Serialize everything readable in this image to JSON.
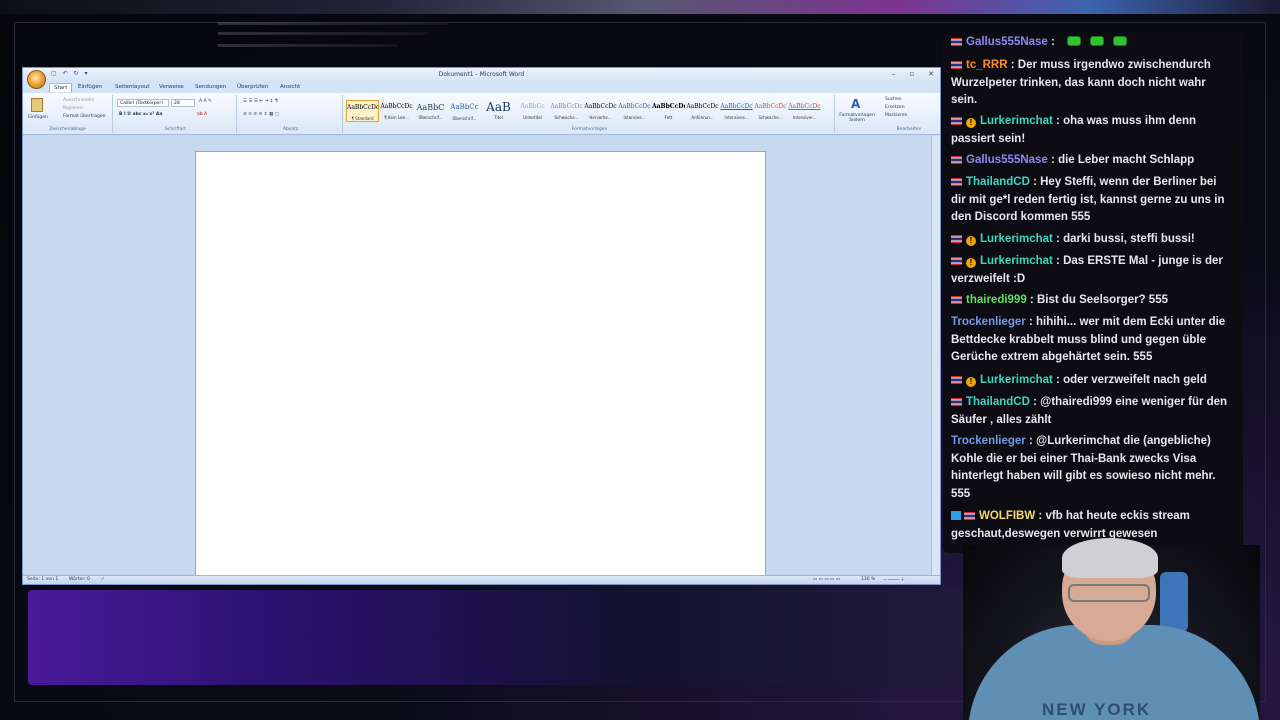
{
  "word": {
    "window_title": "Dokument1 - Microsoft Word",
    "quick_access": "▢ ↶ ↻ ▾",
    "tabs": [
      "Start",
      "Einfügen",
      "Seitenlayout",
      "Verweise",
      "Sendungen",
      "Überprüfen",
      "Ansicht"
    ],
    "clipboard": {
      "paste": "Einfügen",
      "cut": "Ausschneiden",
      "copy": "Kopieren",
      "format_painter": "Format übertragen",
      "label": "Zwischenablage"
    },
    "font": {
      "name": "Calibri (Textkörper)",
      "size": "28",
      "label": "Schriftart"
    },
    "paragraph_label": "Absatz",
    "styles": [
      {
        "preview": "AaBbCcDc",
        "name": "¶ Standard"
      },
      {
        "preview": "AaBbCcDc",
        "name": "¶ Kein Lee..."
      },
      {
        "preview": "AaBbC",
        "name": "Überschrif..."
      },
      {
        "preview": "AaBbCc",
        "name": "Überschrif..."
      },
      {
        "preview": "AaB",
        "name": "Titel"
      },
      {
        "preview": "AaBbCc",
        "name": "Untertitel"
      },
      {
        "preview": "AaBbCcDc",
        "name": "Schwache..."
      },
      {
        "preview": "AaBbCcDc",
        "name": "Hervorhe..."
      },
      {
        "preview": "AaBbCcDc",
        "name": "Intensive..."
      },
      {
        "preview": "AaBbCcDc",
        "name": "Fett"
      },
      {
        "preview": "AaBbCcDc",
        "name": "Anführun..."
      },
      {
        "preview": "AaBbCcDc",
        "name": "Intensives..."
      },
      {
        "preview": "AaBbCcDc",
        "name": "Schwache..."
      },
      {
        "preview": "AaBbCcDc",
        "name": "Intensiver..."
      }
    ],
    "styles_label": "Formatvorlagen",
    "change_styles": "Formatvorlagen ändern",
    "editing": {
      "find": "Suchen",
      "replace": "Ersetzen",
      "select": "Markieren",
      "label": "Bearbeiten"
    },
    "status": {
      "page": "Seite: 1 von 1",
      "words": "Wörter: 0",
      "zoom": "130 %"
    }
  },
  "chat": [
    {
      "user": "Gallus555Nase",
      "color": "#8a8af5",
      "badges": [
        "flag"
      ],
      "text": "",
      "emotes": 3
    },
    {
      "user": "tc_RRR",
      "color": "#ff8c1a",
      "badges": [
        "flag"
      ],
      "text": "Der muss irgendwo zwischendurch Wurzelpeter trinken, das kann doch nicht wahr sein."
    },
    {
      "user": "Lurkerimchat",
      "color": "#3dd6c2",
      "badges": [
        "flag",
        "sub"
      ],
      "text": "oha was muss ihm denn passiert sein!"
    },
    {
      "user": "Gallus555Nase",
      "color": "#8a8af5",
      "badges": [
        "flag"
      ],
      "text": "die Leber macht Schlapp"
    },
    {
      "user": "ThailandCD",
      "color": "#3dd6c2",
      "badges": [
        "flag"
      ],
      "text": "Hey Steffi, wenn der Berliner bei dir mit ge*l reden fertig ist, kannst gerne zu uns in den Discord kommen 555"
    },
    {
      "user": "Lurkerimchat",
      "color": "#3dd6c2",
      "badges": [
        "flag",
        "sub"
      ],
      "text": "darki bussi, steffi bussi!"
    },
    {
      "user": "Lurkerimchat",
      "color": "#3dd6c2",
      "badges": [
        "flag",
        "sub"
      ],
      "text": "Das ERSTE Mal - junge is der verzweifelt :D"
    },
    {
      "user": "thairedi999",
      "color": "#5ee05e",
      "badges": [
        "flag"
      ],
      "text": "Bist du Seelsorger? 555"
    },
    {
      "user": "Trockenlieger",
      "color": "#6f9be8",
      "badges": [],
      "text": "hihihi... wer mit dem Ecki unter die Bettdecke krabbelt muss blind und gegen üble Gerüche extrem abgehärtet sein. 555"
    },
    {
      "user": "Lurkerimchat",
      "color": "#3dd6c2",
      "badges": [
        "flag",
        "sub"
      ],
      "text": "oder verzweifelt nach geld"
    },
    {
      "user": "ThailandCD",
      "color": "#3dd6c2",
      "badges": [
        "flag"
      ],
      "text": "@thairedi999 eine weniger für den Säufer , alles zählt"
    },
    {
      "user": "Trockenlieger",
      "color": "#6f9be8",
      "badges": [],
      "text": "@Lurkerimchat die (angebliche) Kohle die er bei einer Thai-Bank zwecks Visa hinterlegt haben will gibt es sowieso nicht mehr. 555"
    },
    {
      "user": "WOLFIBW",
      "color": "#f5d76e",
      "badges": [
        "vip",
        "flag"
      ],
      "text": "vfb hat heute eckis stream geschaut,deswegen verwirrt gewesen"
    }
  ],
  "webcam": {
    "shirt_text": "NEW YORK"
  }
}
